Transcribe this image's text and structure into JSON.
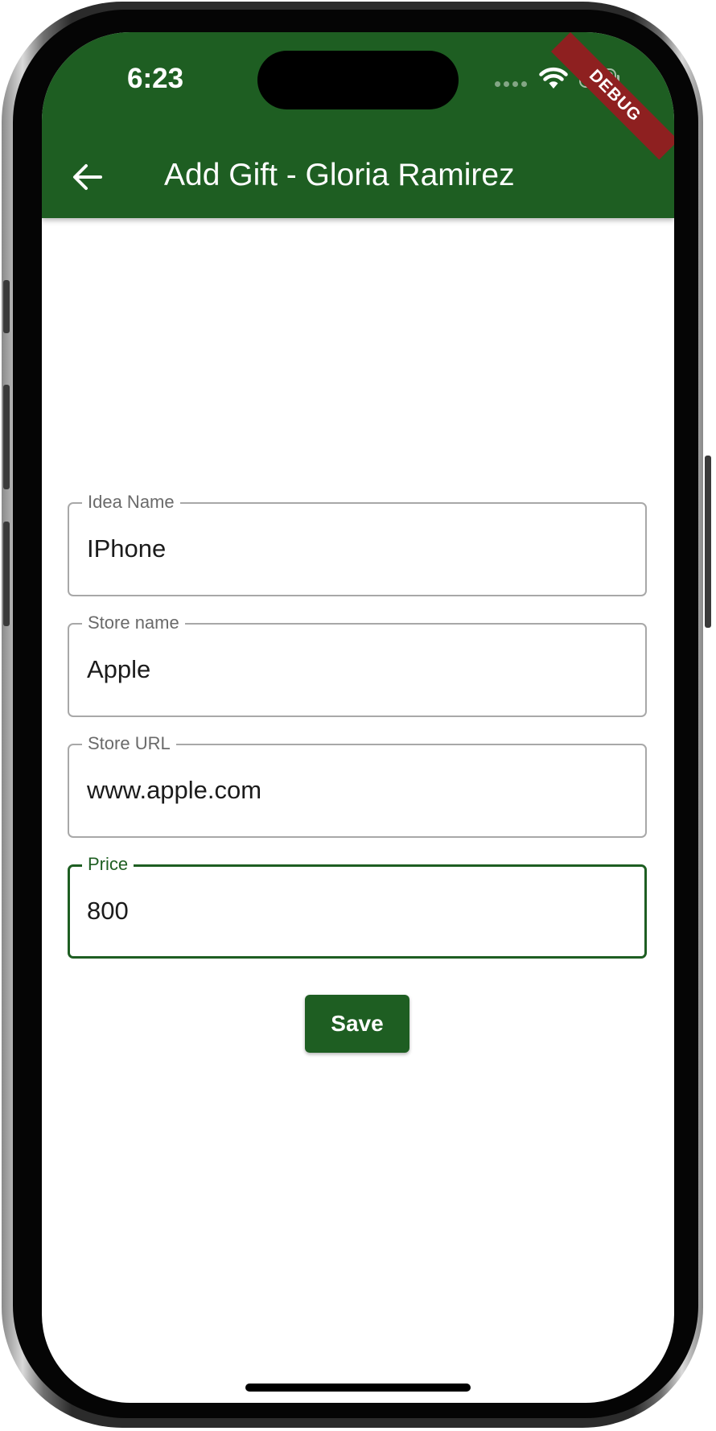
{
  "status_bar": {
    "time": "6:23",
    "icons": [
      "signal-dots-icon",
      "wifi-icon",
      "battery-icon"
    ]
  },
  "debug_banner": "DEBUG",
  "app_bar": {
    "back_icon": "arrow-back-icon",
    "title": "Add Gift - Gloria Ramirez"
  },
  "form": {
    "fields": [
      {
        "label": "Idea Name",
        "value": "IPhone",
        "focused": false
      },
      {
        "label": "Store name",
        "value": "Apple",
        "focused": false
      },
      {
        "label": "Store URL",
        "value": "www.apple.com",
        "focused": false
      },
      {
        "label": "Price",
        "value": "800",
        "focused": true
      }
    ],
    "save_label": "Save"
  },
  "colors": {
    "primary": "#1e5e22",
    "debug_banner": "#8e2020",
    "field_border": "#a8a8a8"
  }
}
